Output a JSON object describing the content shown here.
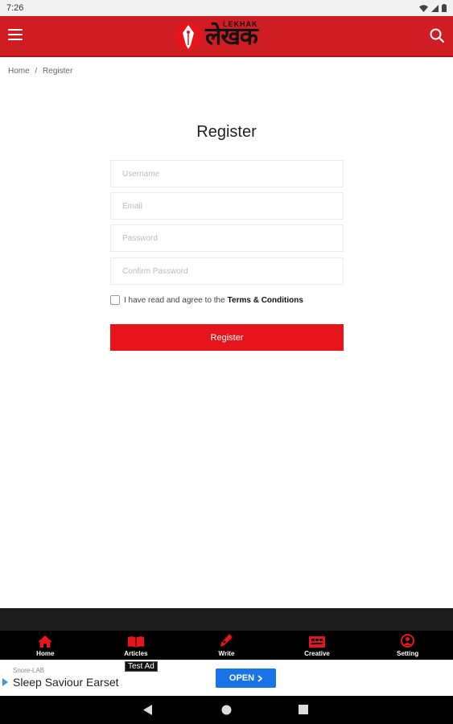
{
  "status_bar": {
    "time": "7:26"
  },
  "header": {
    "logo_small": "LEKHAK",
    "logo_text": "लेखक"
  },
  "breadcrumb": {
    "home": "Home",
    "separator": "/",
    "current": "Register"
  },
  "form": {
    "title": "Register",
    "username_placeholder": "Username",
    "email_placeholder": "Email",
    "password_placeholder": "Password",
    "confirm_placeholder": "Confirm Password",
    "agree_text": "I have read and agree to the",
    "terms_link": "Terms & Conditions",
    "submit_label": "Register",
    "agreed": false
  },
  "bottom_nav": {
    "items": [
      {
        "label": "Home",
        "icon": "home-icon"
      },
      {
        "label": "Articles",
        "icon": "book-icon"
      },
      {
        "label": "Write",
        "icon": "pen-icon"
      },
      {
        "label": "Creative",
        "icon": "image-icon"
      },
      {
        "label": "Setting",
        "icon": "user-circle-icon"
      }
    ]
  },
  "ad": {
    "test_label": "Test Ad",
    "sponsor": "Snore-LAB",
    "title": "Sleep Saviour Earset",
    "cta": "OPEN"
  },
  "colors": {
    "brand_red": "#cf1d23",
    "button_red": "#e8141b",
    "nav_icon_red": "#e8141b",
    "ad_blue": "#1a73e8"
  }
}
